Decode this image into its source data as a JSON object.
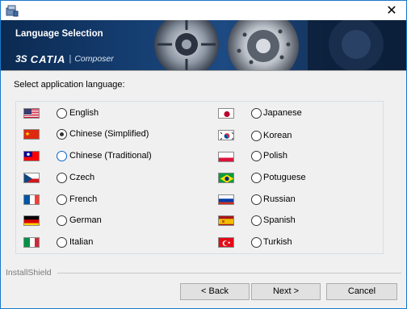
{
  "window": {
    "close_glyph": "✕"
  },
  "banner": {
    "title": "Language Selection",
    "logo_mark": "3S",
    "logo_brand": "CATIA",
    "logo_separator": "|",
    "logo_product": "Composer",
    "color_bg": "#143c6e"
  },
  "prompt": "Select application language:",
  "languages_left": [
    {
      "label": "English",
      "flag": "us-flag-icon",
      "checked": false,
      "focused": false
    },
    {
      "label": "Chinese (Simplified)",
      "flag": "china-flag-icon",
      "checked": true,
      "focused": false
    },
    {
      "label": "Chinese (Traditional)",
      "flag": "taiwan-flag-icon",
      "checked": false,
      "focused": true
    },
    {
      "label": "Czech",
      "flag": "czech-flag-icon",
      "checked": false,
      "focused": false
    },
    {
      "label": "French",
      "flag": "france-flag-icon",
      "checked": false,
      "focused": false
    },
    {
      "label": "German",
      "flag": "germany-flag-icon",
      "checked": false,
      "focused": false
    },
    {
      "label": "Italian",
      "flag": "italy-flag-icon",
      "checked": false,
      "focused": false
    }
  ],
  "languages_right": [
    {
      "label": "Japanese",
      "flag": "japan-flag-icon",
      "checked": false
    },
    {
      "label": "Korean",
      "flag": "korea-flag-icon",
      "checked": false
    },
    {
      "label": "Polish",
      "flag": "poland-flag-icon",
      "checked": false
    },
    {
      "label": "Potuguese",
      "flag": "brazil-flag-icon",
      "checked": false
    },
    {
      "label": "Russian",
      "flag": "russia-flag-icon",
      "checked": false
    },
    {
      "label": "Spanish",
      "flag": "spain-flag-icon",
      "checked": false
    },
    {
      "label": "Turkish",
      "flag": "turkey-flag-icon",
      "checked": false
    }
  ],
  "footer": {
    "brand": "InstallShield",
    "back_label": "< Back",
    "next_label": "Next >",
    "cancel_label": "Cancel"
  }
}
